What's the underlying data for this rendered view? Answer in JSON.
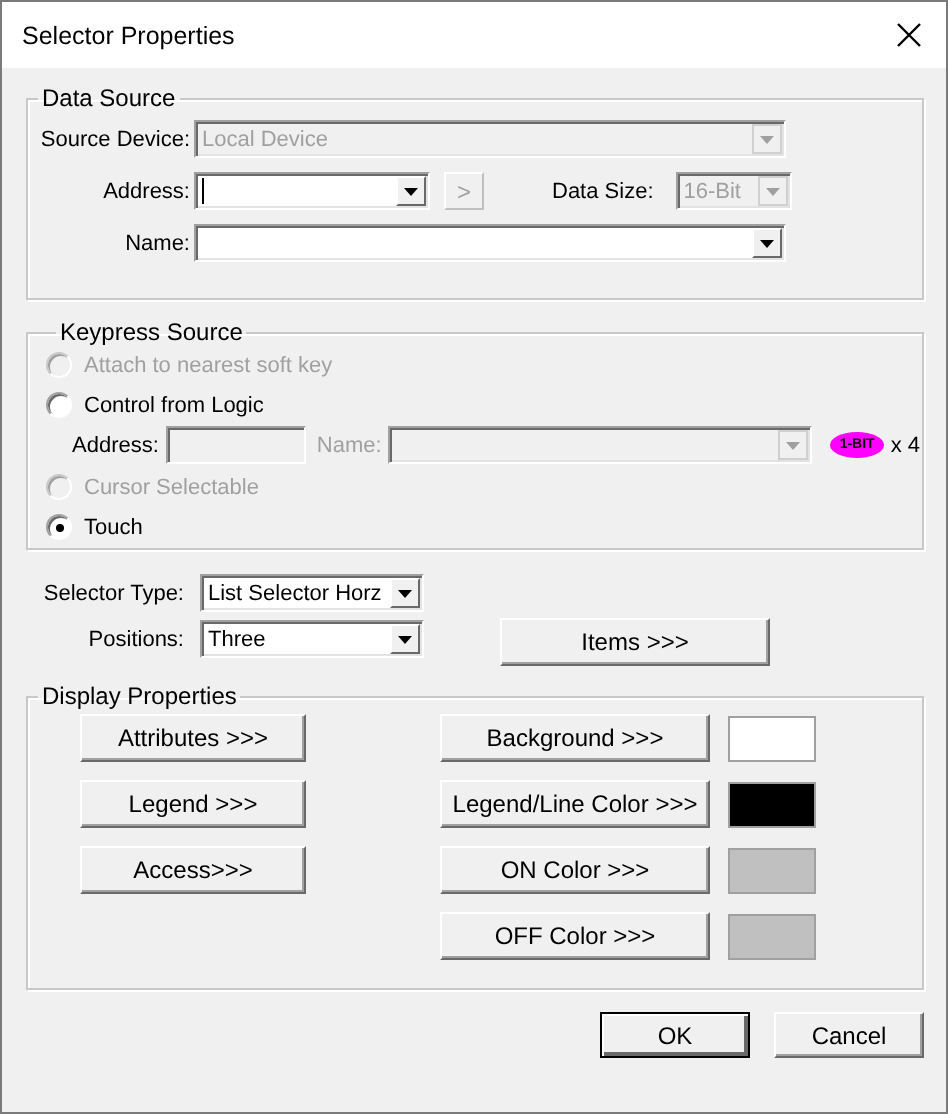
{
  "window": {
    "title": "Selector Properties"
  },
  "data_source": {
    "title": "Data Source",
    "source_device": {
      "label": "Source Device:",
      "value": "Local Device",
      "disabled": true
    },
    "address": {
      "label": "Address:",
      "focused": true
    },
    "next_button": {
      "label": ">",
      "disabled": true
    },
    "data_size": {
      "label": "Data Size:",
      "value": "16-Bit",
      "disabled": true
    },
    "name": {
      "label": "Name:"
    }
  },
  "keypress_source": {
    "title": "Keypress Source",
    "options": [
      {
        "label": "Attach to nearest soft key",
        "selected": false,
        "disabled": true
      },
      {
        "label": "Control from Logic",
        "selected": false,
        "disabled": false,
        "fields": {
          "address_label": "Address:",
          "name_label": "Name:",
          "disabled": true,
          "badge": "1-BIT",
          "multiplier": "x 4"
        }
      },
      {
        "label": "Cursor Selectable",
        "selected": false,
        "disabled": true
      },
      {
        "label": "Touch",
        "selected": true,
        "disabled": false
      }
    ]
  },
  "selector": {
    "type": {
      "label": "Selector Type:",
      "value": "List Selector Horz"
    },
    "positions": {
      "label": "Positions:",
      "value": "Three"
    },
    "items_button": "Items >>>"
  },
  "display_properties": {
    "title": "Display Properties",
    "buttons": [
      "Attributes >>>",
      "Legend >>>",
      "Access>>>"
    ],
    "color_buttons": [
      {
        "label": "Background >>>",
        "color": "#ffffff"
      },
      {
        "label": "Legend/Line Color >>>",
        "color": "#000000"
      },
      {
        "label": "ON Color >>>",
        "color": "#c0c0c0"
      },
      {
        "label": "OFF Color >>>",
        "color": "#c0c0c0"
      }
    ]
  },
  "buttons": [
    {
      "label": "OK",
      "default": true
    },
    {
      "label": "Cancel",
      "default": false
    }
  ]
}
